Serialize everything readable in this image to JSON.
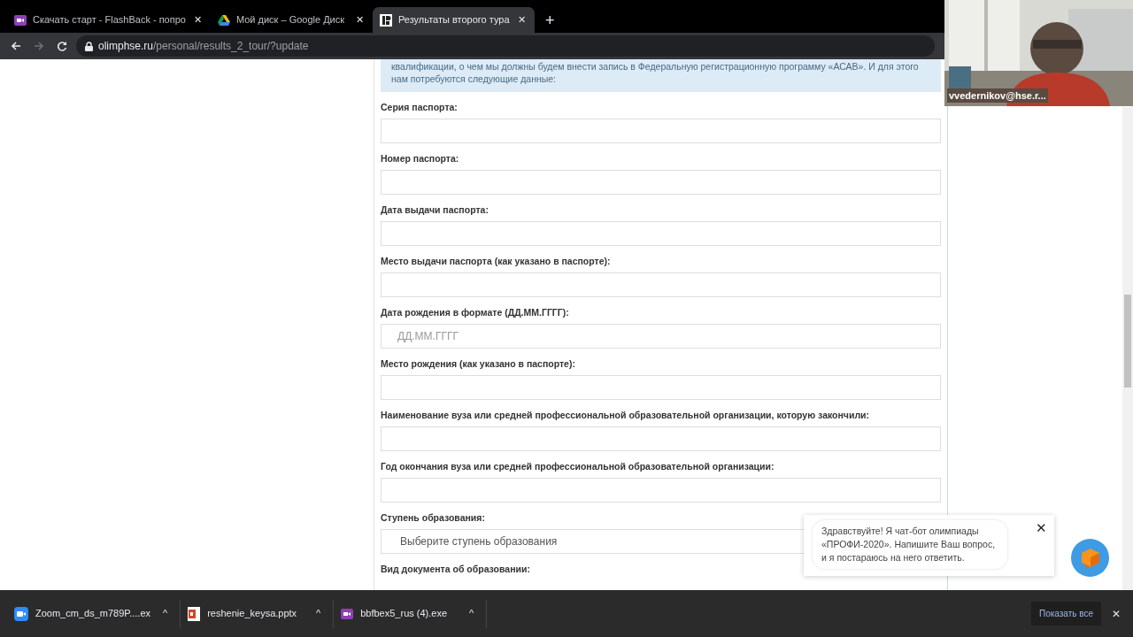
{
  "browser": {
    "tabs": [
      {
        "title": "Скачать старт - FlashBack - попро",
        "selected": false
      },
      {
        "title": "Мой диск – Google Диск",
        "selected": false
      },
      {
        "title": "Результаты второго тура",
        "selected": true
      }
    ],
    "tab_close": "✕",
    "new_tab": "+",
    "url_host": "olimphse.ru",
    "url_path": "/personal/results_2_tour/?update"
  },
  "notice": "квалификации, о чем мы должны будем внести запись в Федеральную регистрационную программу «АСАВ». И для этого нам потребуются следующие данные:",
  "fields": [
    {
      "label": "Серия паспорта:",
      "kind": "text"
    },
    {
      "label": "Номер паспорта:",
      "kind": "text"
    },
    {
      "label": "Дата выдачи паспорта:",
      "kind": "text"
    },
    {
      "label": "Место выдачи паспорта (как указано в паспорте):",
      "kind": "text"
    },
    {
      "label": "Дата рождения в формате (ДД.ММ.ГГГГ):",
      "kind": "text",
      "placeholder": "ДД.ММ.ГГГГ"
    },
    {
      "label": "Место рождения (как указано в паспорте):",
      "kind": "text"
    },
    {
      "label": "Наименование вуза или средней профессиональной образовательной организации, которую закончили:",
      "kind": "text"
    },
    {
      "label": "Год окончания вуза или средней профессиональной образовательной организации:",
      "kind": "text"
    },
    {
      "label": "Ступень образования:",
      "kind": "select",
      "value": "Выберите ступень образования"
    },
    {
      "label": "Вид документа об образовании:",
      "kind": "label"
    }
  ],
  "video": {
    "kind": "picture",
    "name": "vvedernikov@hse.r..."
  },
  "chat": {
    "message": "Здравствуйте! Я чат-бот олимпиады «ПРОФИ-2020». Напишите Ваш вопрос, и я постараюсь на него ответить.",
    "close": "✕"
  },
  "downloads": {
    "items": [
      {
        "name": "Zoom_cm_ds_m789P....ex",
        "caret": "^"
      },
      {
        "name": "reshenie_keysa.pptx",
        "caret": "^"
      },
      {
        "name": "bbfbex5_rus (4).exe",
        "caret": "^"
      }
    ],
    "show_all": "Показать все",
    "close": "✕"
  }
}
